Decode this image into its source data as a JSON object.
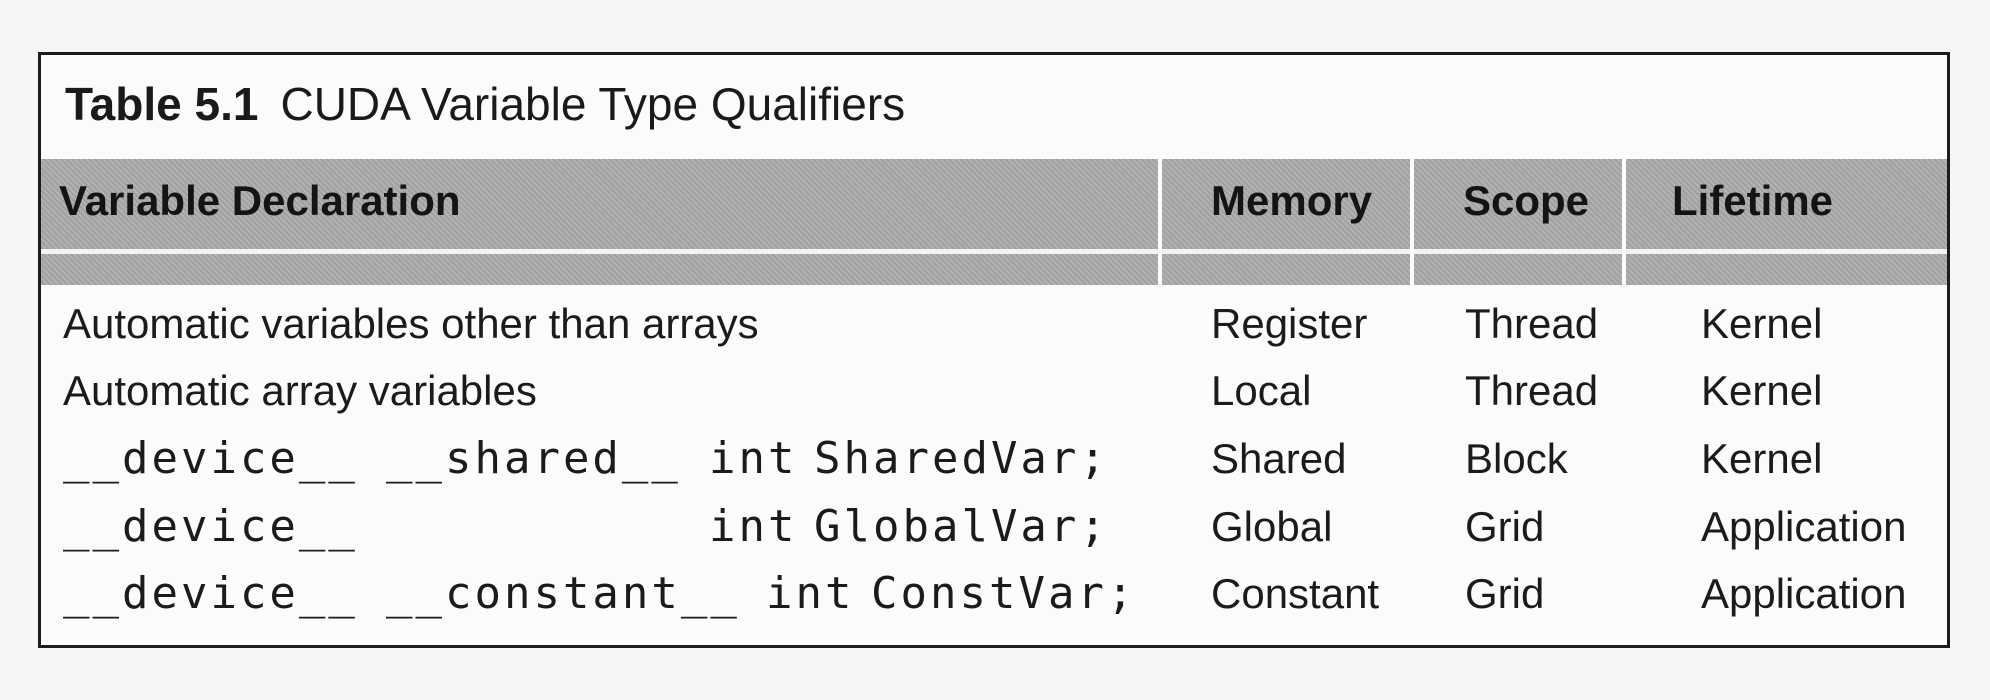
{
  "table": {
    "number": "Table 5.1",
    "title": "CUDA Variable Type Qualifiers",
    "headers": {
      "declaration": "Variable Declaration",
      "memory": "Memory",
      "scope": "Scope",
      "lifetime": "Lifetime"
    },
    "rows": [
      {
        "declaration": "Automatic variables other than arrays",
        "memory": "Register",
        "scope": "Thread",
        "lifetime": "Kernel"
      },
      {
        "declaration": "Automatic array variables",
        "memory": "Local",
        "scope": "Thread",
        "lifetime": "Kernel"
      },
      {
        "qualifier1": "__device__",
        "qualifier2": "__shared__",
        "decl_type": "int",
        "decl_var": "SharedVar;",
        "memory": "Shared",
        "scope": "Block",
        "lifetime": "Kernel"
      },
      {
        "qualifier1": "__device__",
        "decl_type": "int",
        "decl_var": "GlobalVar;",
        "memory": "Global",
        "scope": "Grid",
        "lifetime": "Application"
      },
      {
        "qualifier1": "__device__",
        "qualifier2": "__constant__",
        "decl_type": "int",
        "decl_var": "ConstVar;",
        "memory": "Constant",
        "scope": "Grid",
        "lifetime": "Application"
      }
    ]
  }
}
